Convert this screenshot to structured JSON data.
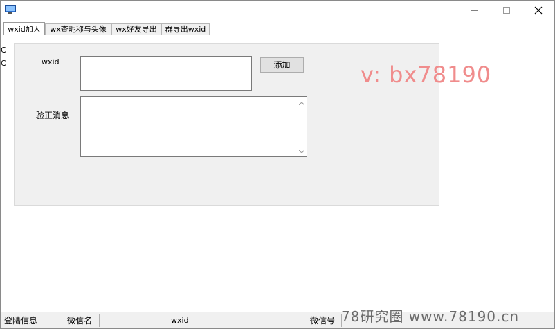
{
  "tabs": [
    "wxid加人",
    "wx查昵称与头像",
    "wx好友导出",
    "群导出wxid"
  ],
  "form": {
    "wxid_label": "wxid",
    "wxid_value": "",
    "add_button": "添加",
    "verify_label": "验正消息",
    "verify_value": ""
  },
  "watermark": "v:  bx78190",
  "statusbar": {
    "login_info": "登陆信息",
    "wechat_name_label": "微信名",
    "wxid_label": "wxid",
    "wechat_id_label": "微信号"
  },
  "site_watermark": "78研究圈 www.78190.cn",
  "stray_chars": [
    "C",
    "C"
  ]
}
